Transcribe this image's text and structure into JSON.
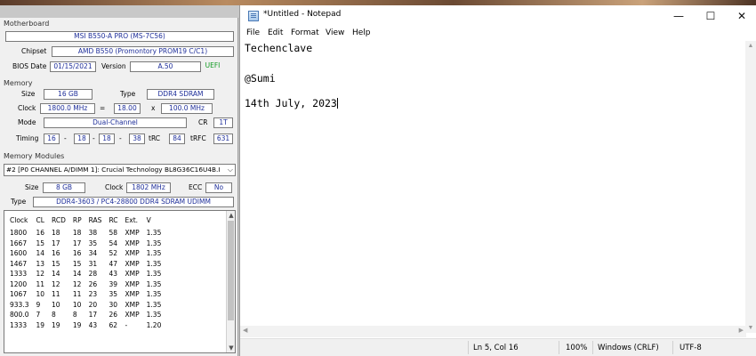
{
  "cpuz": {
    "motherboard": {
      "group": "Motherboard",
      "model": "MSI B550-A PRO (MS-7C56)",
      "chipset_label": "Chipset",
      "chipset": "AMD B550 (Promontory PROM19 C/C1)",
      "bios_date_label": "BIOS Date",
      "bios_date": "01/15/2021",
      "version_label": "Version",
      "version": "A.50",
      "uefi": "UEFI"
    },
    "memory": {
      "group": "Memory",
      "size_label": "Size",
      "size": "16 GB",
      "type_label": "Type",
      "type": "DDR4 SDRAM",
      "clock_label": "Clock",
      "clock": "1800.0 MHz",
      "eq": "=",
      "mult": "18.00",
      "x": "x",
      "fsb": "100.0 MHz",
      "mode_label": "Mode",
      "mode": "Dual-Channel",
      "cr_label": "CR",
      "cr": "1T",
      "timing_label": "Timing",
      "t1": "16",
      "t2": "18",
      "t3": "18",
      "t4": "38",
      "dash": "-",
      "trc_label": "tRC",
      "trc": "84",
      "trfc_label": "tRFC",
      "trfc": "631"
    },
    "modules": {
      "group": "Memory Modules",
      "selected": "#2 [P0 CHANNEL A/DIMM 1]: Crucial Technology BL8G36C16U4B.I",
      "size_label": "Size",
      "size": "8 GB",
      "clock_label": "Clock",
      "clock": "1802 MHz",
      "ecc_label": "ECC",
      "ecc": "No",
      "type_label": "Type",
      "type": "DDR4-3603 / PC4-28800 DDR4 SDRAM UDIMM"
    },
    "table": {
      "headers": [
        "Clock",
        "CL",
        "RCD",
        "RP",
        "RAS",
        "RC",
        "Ext.",
        "V"
      ],
      "rows": [
        [
          "1800",
          "16",
          "18",
          "18",
          "38",
          "58",
          "XMP",
          "1.35"
        ],
        [
          "1667",
          "15",
          "17",
          "17",
          "35",
          "54",
          "XMP",
          "1.35"
        ],
        [
          "1600",
          "14",
          "16",
          "16",
          "34",
          "52",
          "XMP",
          "1.35"
        ],
        [
          "1467",
          "13",
          "15",
          "15",
          "31",
          "47",
          "XMP",
          "1.35"
        ],
        [
          "1333",
          "12",
          "14",
          "14",
          "28",
          "43",
          "XMP",
          "1.35"
        ],
        [
          "1200",
          "11",
          "12",
          "12",
          "26",
          "39",
          "XMP",
          "1.35"
        ],
        [
          "1067",
          "10",
          "11",
          "11",
          "23",
          "35",
          "XMP",
          "1.35"
        ],
        [
          "933.3",
          "9",
          "10",
          "10",
          "20",
          "30",
          "XMP",
          "1.35"
        ],
        [
          "800.0",
          "7",
          "8",
          "8",
          "17",
          "26",
          "XMP",
          "1.35"
        ],
        [
          "1333",
          "19",
          "19",
          "19",
          "43",
          "62",
          "-",
          "1.20"
        ]
      ]
    }
  },
  "notepad": {
    "title": "*Untitled - Notepad",
    "window_controls": {
      "minimize": "—",
      "maximize": "☐",
      "close": "✕"
    },
    "menu": [
      "File",
      "Edit",
      "Format",
      "View",
      "Help"
    ],
    "lines": [
      "Techenclave",
      "",
      "@Sumi",
      "",
      "14th July, 2023"
    ],
    "status": {
      "position": "Ln 5, Col 16",
      "zoom": "100%",
      "line_endings": "Windows (CRLF)",
      "encoding": "UTF-8"
    }
  }
}
